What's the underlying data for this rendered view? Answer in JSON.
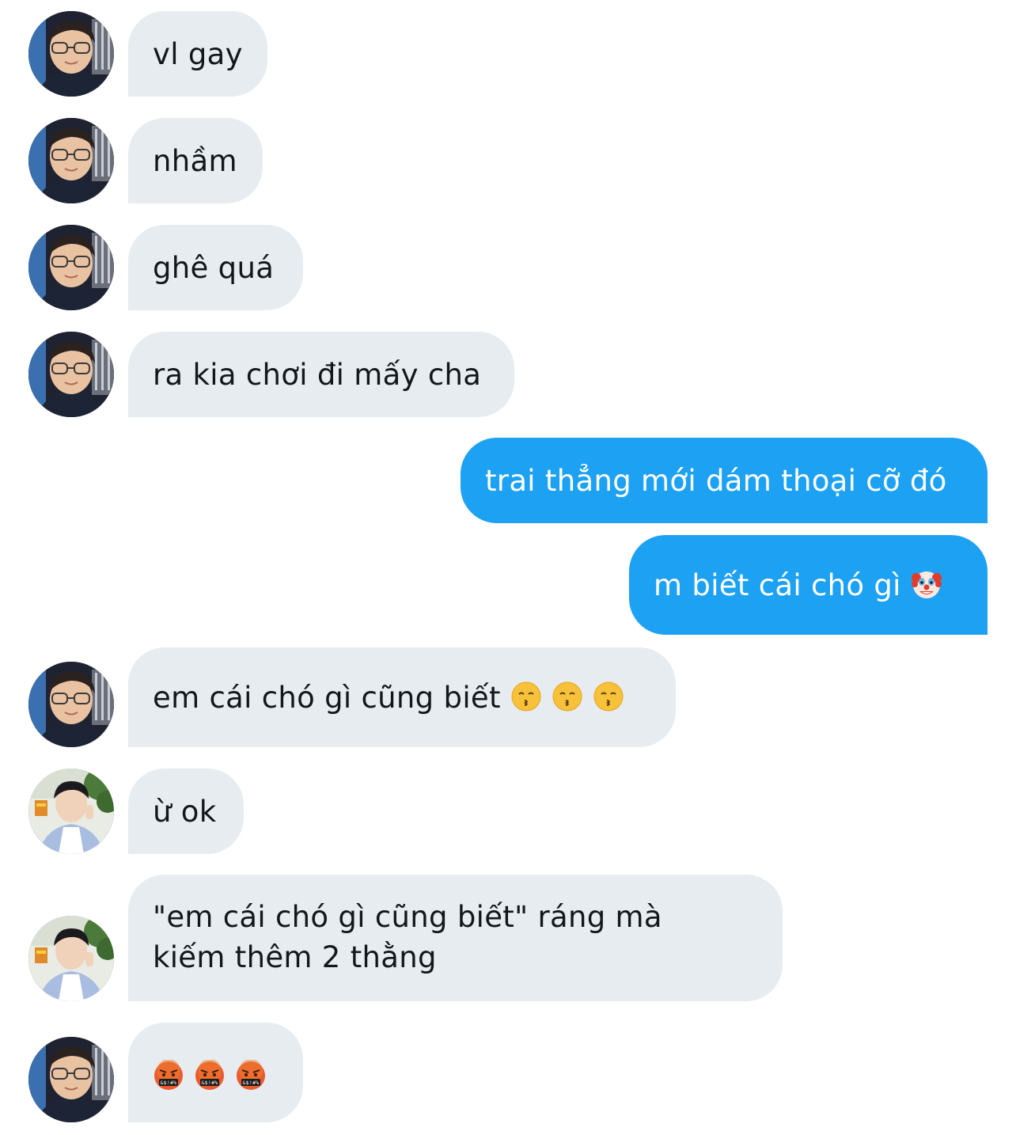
{
  "conversation": {
    "messages": [
      {
        "direction": "incoming",
        "sender": "friend-a",
        "text": "vl gay"
      },
      {
        "direction": "incoming",
        "sender": "friend-a",
        "text": "nhầm"
      },
      {
        "direction": "incoming",
        "sender": "friend-a",
        "text": "ghê quá"
      },
      {
        "direction": "incoming",
        "sender": "friend-a",
        "text": "ra kia chơi đi mấy cha"
      },
      {
        "direction": "outgoing",
        "sender": "me",
        "text": "trai thẳng mới dám thoại cỡ đó"
      },
      {
        "direction": "outgoing",
        "sender": "me",
        "text": "m biết cái chó gì",
        "emojis": [
          "clown-face"
        ]
      },
      {
        "direction": "incoming",
        "sender": "friend-a",
        "text": "em cái chó gì cũng biết",
        "emojis": [
          "kissing-face",
          "kissing-face",
          "kissing-face"
        ]
      },
      {
        "direction": "incoming",
        "sender": "friend-b",
        "text": "ừ ok"
      },
      {
        "direction": "incoming",
        "sender": "friend-b",
        "lines": [
          "\"em cái chó gì cũng biết\" ráng mà",
          "kiếm thêm 2 thằng"
        ]
      },
      {
        "direction": "incoming",
        "sender": "friend-a",
        "text": "",
        "emojis": [
          "face-with-symbols-on-mouth",
          "face-with-symbols-on-mouth",
          "face-with-symbols-on-mouth"
        ]
      }
    ]
  },
  "colors": {
    "incoming_bubble": "#e6ecf0",
    "outgoing_bubble": "#1da1f2",
    "incoming_text": "#14171a",
    "outgoing_text": "#ffffff"
  }
}
